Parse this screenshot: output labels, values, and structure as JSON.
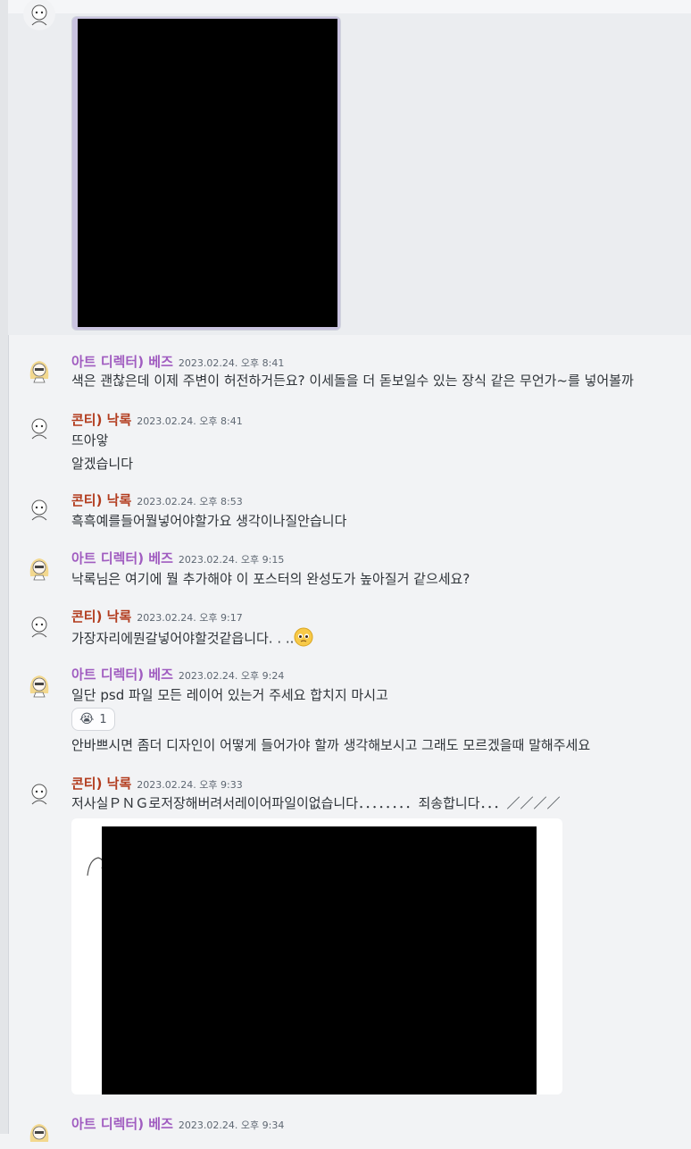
{
  "messages": [
    {
      "author": "아트 디렉터) 베즈",
      "time": "2023.02.24. 오후 8:41",
      "lines": [
        "색은 괜찮은데 이제 주변이 허전하거든요? 이세돌을 더 돋보일수 있는 장식 같은 무언가~를 넣어볼까"
      ]
    },
    {
      "author": "콘티) 낙록",
      "time": "2023.02.24. 오후 8:41",
      "lines": [
        "뜨아앟",
        "알겠습니다"
      ]
    },
    {
      "author": "콘티) 낙록",
      "time": "2023.02.24. 오후 8:53",
      "lines": [
        "흑흑예를들어뭘넣어야할가요 생각이나질안습니다"
      ]
    },
    {
      "author": "아트 디렉터) 베즈",
      "time": "2023.02.24. 오후 9:15",
      "lines": [
        "낙록님은 여기에 뭘 추가해야 이 포스터의 완성도가 높아질거 같으세요?"
      ]
    },
    {
      "author": "콘티) 낙록",
      "time": "2023.02.24. 오후 9:17",
      "lines": [
        "가장자리에뭔갈넣어야할것같읍니다. . .."
      ]
    },
    {
      "author": "아트 디렉터) 베즈",
      "time": "2023.02.24. 오후 9:24",
      "lines": [
        "일단 psd 파일 모든 레이어 있는거 주세요 합치지 마시고",
        "안바쁘시면 좀더 디자인이 어떻게 들어가야 할까 생각해보시고 그래도 모르겠을때 말해주세요"
      ],
      "reaction": {
        "emoji": "😭",
        "count": "1"
      }
    },
    {
      "author": "콘티) 낙록",
      "time": "2023.02.24. 오후 9:33",
      "lines": [
        "저사실ＰＮＧ로저장해버려서레이어파일이없습니다．．．．．．．．죄송합니다．．．／／／／"
      ]
    },
    {
      "author": "아트 디렉터) 베즈",
      "time": "2023.02.24. 오후 9:34",
      "lines": []
    }
  ],
  "colors": {
    "art_director": "#a05cc0",
    "conti": "#b23c1e",
    "background": "#f2f3f5"
  },
  "icons": {
    "emoji_inline": "pleading-face-emoji",
    "reaction": "crying-face-emoji"
  }
}
